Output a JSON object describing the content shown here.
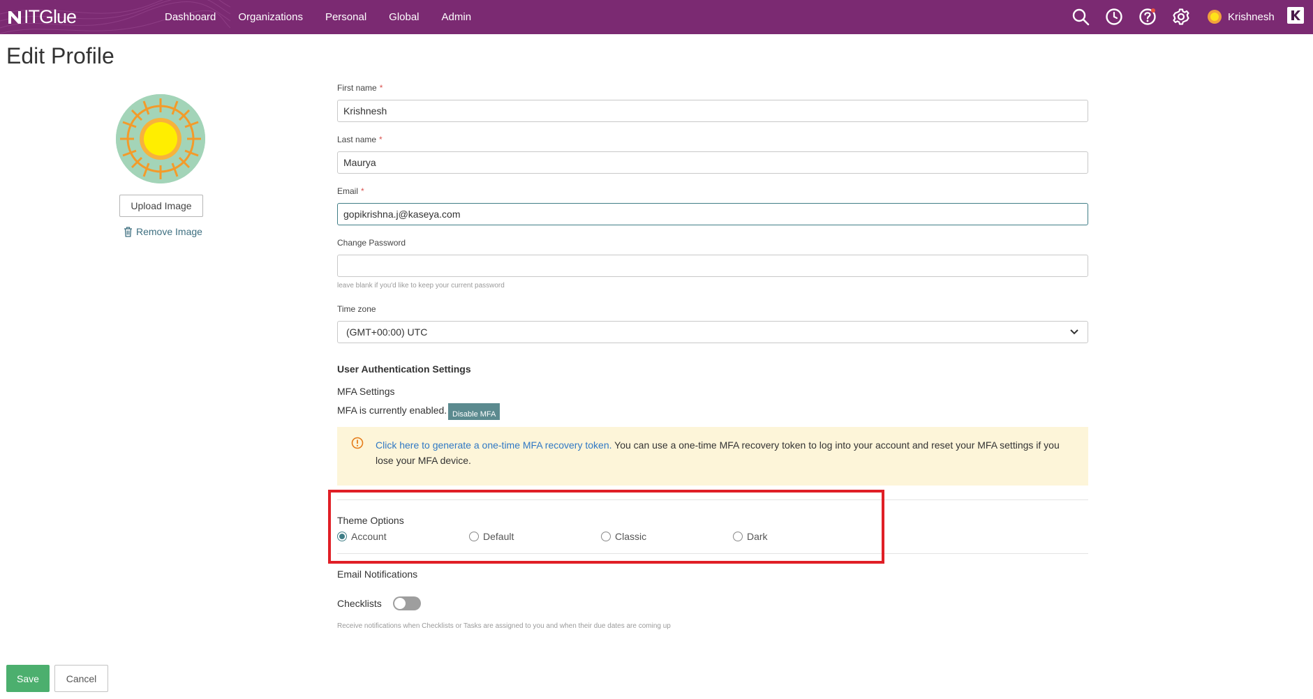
{
  "header": {
    "logo_text": "ITGlue",
    "nav": [
      {
        "label": "Dashboard"
      },
      {
        "label": "Organizations"
      },
      {
        "label": "Personal"
      },
      {
        "label": "Global"
      },
      {
        "label": "Admin"
      }
    ],
    "icons": [
      "search-icon",
      "clock-icon",
      "help-icon",
      "gear-icon"
    ],
    "user_name": "Krishnesh",
    "brand_color": "#7b2a72"
  },
  "page": {
    "title": "Edit Profile"
  },
  "avatar": {
    "upload_label": "Upload Image",
    "remove_label": "Remove Image"
  },
  "form": {
    "first_name": {
      "label": "First name",
      "required_mark": "*",
      "value": "Krishnesh"
    },
    "last_name": {
      "label": "Last name",
      "required_mark": "*",
      "value": "Maurya"
    },
    "email": {
      "label": "Email",
      "required_mark": "*",
      "value": "gopikrishna.j@kaseya.com"
    },
    "password": {
      "label": "Change Password",
      "value": "",
      "hint": "leave blank if you'd like to keep your current password"
    },
    "timezone": {
      "label": "Time zone",
      "value": "(GMT+00:00) UTC"
    }
  },
  "auth": {
    "heading": "User Authentication Settings",
    "mfa_settings_label": "MFA Settings",
    "mfa_status": "MFA is currently enabled.",
    "disable_mfa_label": "Disable MFA",
    "notice_link": "Click here to generate a one-time MFA recovery token.",
    "notice_text": " You can use a one-time MFA recovery token to log into your account and reset your MFA settings if you lose your MFA device."
  },
  "theme": {
    "label": "Theme Options",
    "options": [
      {
        "label": "Account",
        "selected": true
      },
      {
        "label": "Default",
        "selected": false
      },
      {
        "label": "Classic",
        "selected": false
      },
      {
        "label": "Dark",
        "selected": false
      }
    ]
  },
  "notifications": {
    "heading": "Email Notifications",
    "checklists_label": "Checklists",
    "checklists_enabled": false,
    "hint": "Receive notifications when Checklists or Tasks are assigned to you and when their due dates are coming up"
  },
  "footer": {
    "save_label": "Save",
    "cancel_label": "Cancel"
  }
}
